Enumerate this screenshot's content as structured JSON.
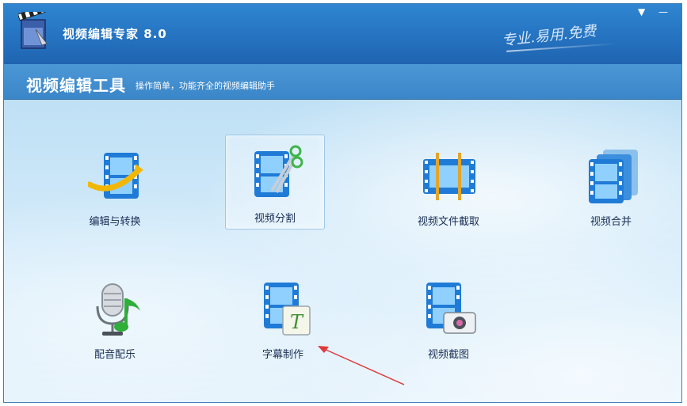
{
  "window": {
    "title": "视频编辑专家 8.0",
    "slogan": "专业.易用.免费",
    "controls": {
      "menu": "▼",
      "minimize": "—"
    }
  },
  "banner": {
    "title": "视频编辑工具",
    "subtitle": "操作简单，功能齐全的视频编辑助手"
  },
  "tools": [
    {
      "label": "编辑与转换",
      "icon": "film-edit-convert-icon",
      "selected": false
    },
    {
      "label": "视频分割",
      "icon": "film-scissors-icon",
      "selected": true
    },
    {
      "label": "视频文件截取",
      "icon": "film-clip-icon",
      "selected": false
    },
    {
      "label": "视频合并",
      "icon": "film-merge-icon",
      "selected": false
    },
    {
      "label": "配音配乐",
      "icon": "microphone-music-icon",
      "selected": false
    },
    {
      "label": "字幕制作",
      "icon": "film-subtitle-icon",
      "selected": false
    },
    {
      "label": "视频截图",
      "icon": "film-camera-icon",
      "selected": false
    }
  ],
  "colors": {
    "titlebar": "#2573c1",
    "banner": "#3a86c8",
    "film": "#1f7bd6",
    "annotation_arrow": "#e0393b"
  }
}
